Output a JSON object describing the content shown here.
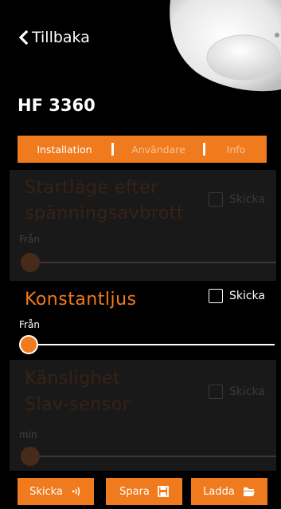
{
  "header": {
    "back_label": "Tillbaka",
    "device_title": "HF 3360"
  },
  "tabs": [
    {
      "label": "Installation",
      "active": true
    },
    {
      "label": "Användare",
      "active": false
    },
    {
      "label": "Info",
      "active": false
    }
  ],
  "panels": {
    "startup": {
      "title_line1": "Startläge efter",
      "title_line2": "spänningsavbrott",
      "send_label": "Skicka",
      "value_label": "Från",
      "slider_fraction": 0,
      "enabled": false
    },
    "constant_light": {
      "title": "Konstantljus",
      "send_label": "Skicka",
      "value_label": "Från",
      "slider_fraction": 0,
      "enabled": true
    },
    "sensitivity": {
      "title_line1": "Känslighet",
      "title_line2": "Slav-sensor",
      "send_label": "Skicka",
      "value_label": "min",
      "slider_fraction": 0,
      "enabled": false
    }
  },
  "footer": {
    "send_label": "Skicka",
    "save_label": "Spara",
    "load_label": "Ladda"
  },
  "colors": {
    "accent": "#f07a1e",
    "background": "#000000",
    "panel": "#1b1b1b"
  },
  "icons": {
    "back": "chevron-left-icon",
    "send": "signal-icon",
    "save": "floppy-disk-icon",
    "load": "folder-open-icon"
  }
}
